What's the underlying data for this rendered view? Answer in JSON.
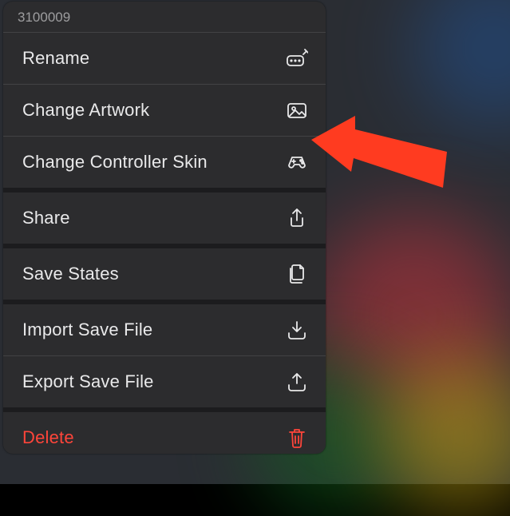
{
  "menu": {
    "title": "3100009",
    "items": {
      "rename": "Rename",
      "artwork": "Change Artwork",
      "skin": "Change Controller Skin",
      "share": "Share",
      "states": "Save States",
      "import": "Import Save File",
      "export": "Export Save File",
      "delete": "Delete"
    }
  },
  "annotation": {
    "arrow_color": "#ff3b20"
  }
}
